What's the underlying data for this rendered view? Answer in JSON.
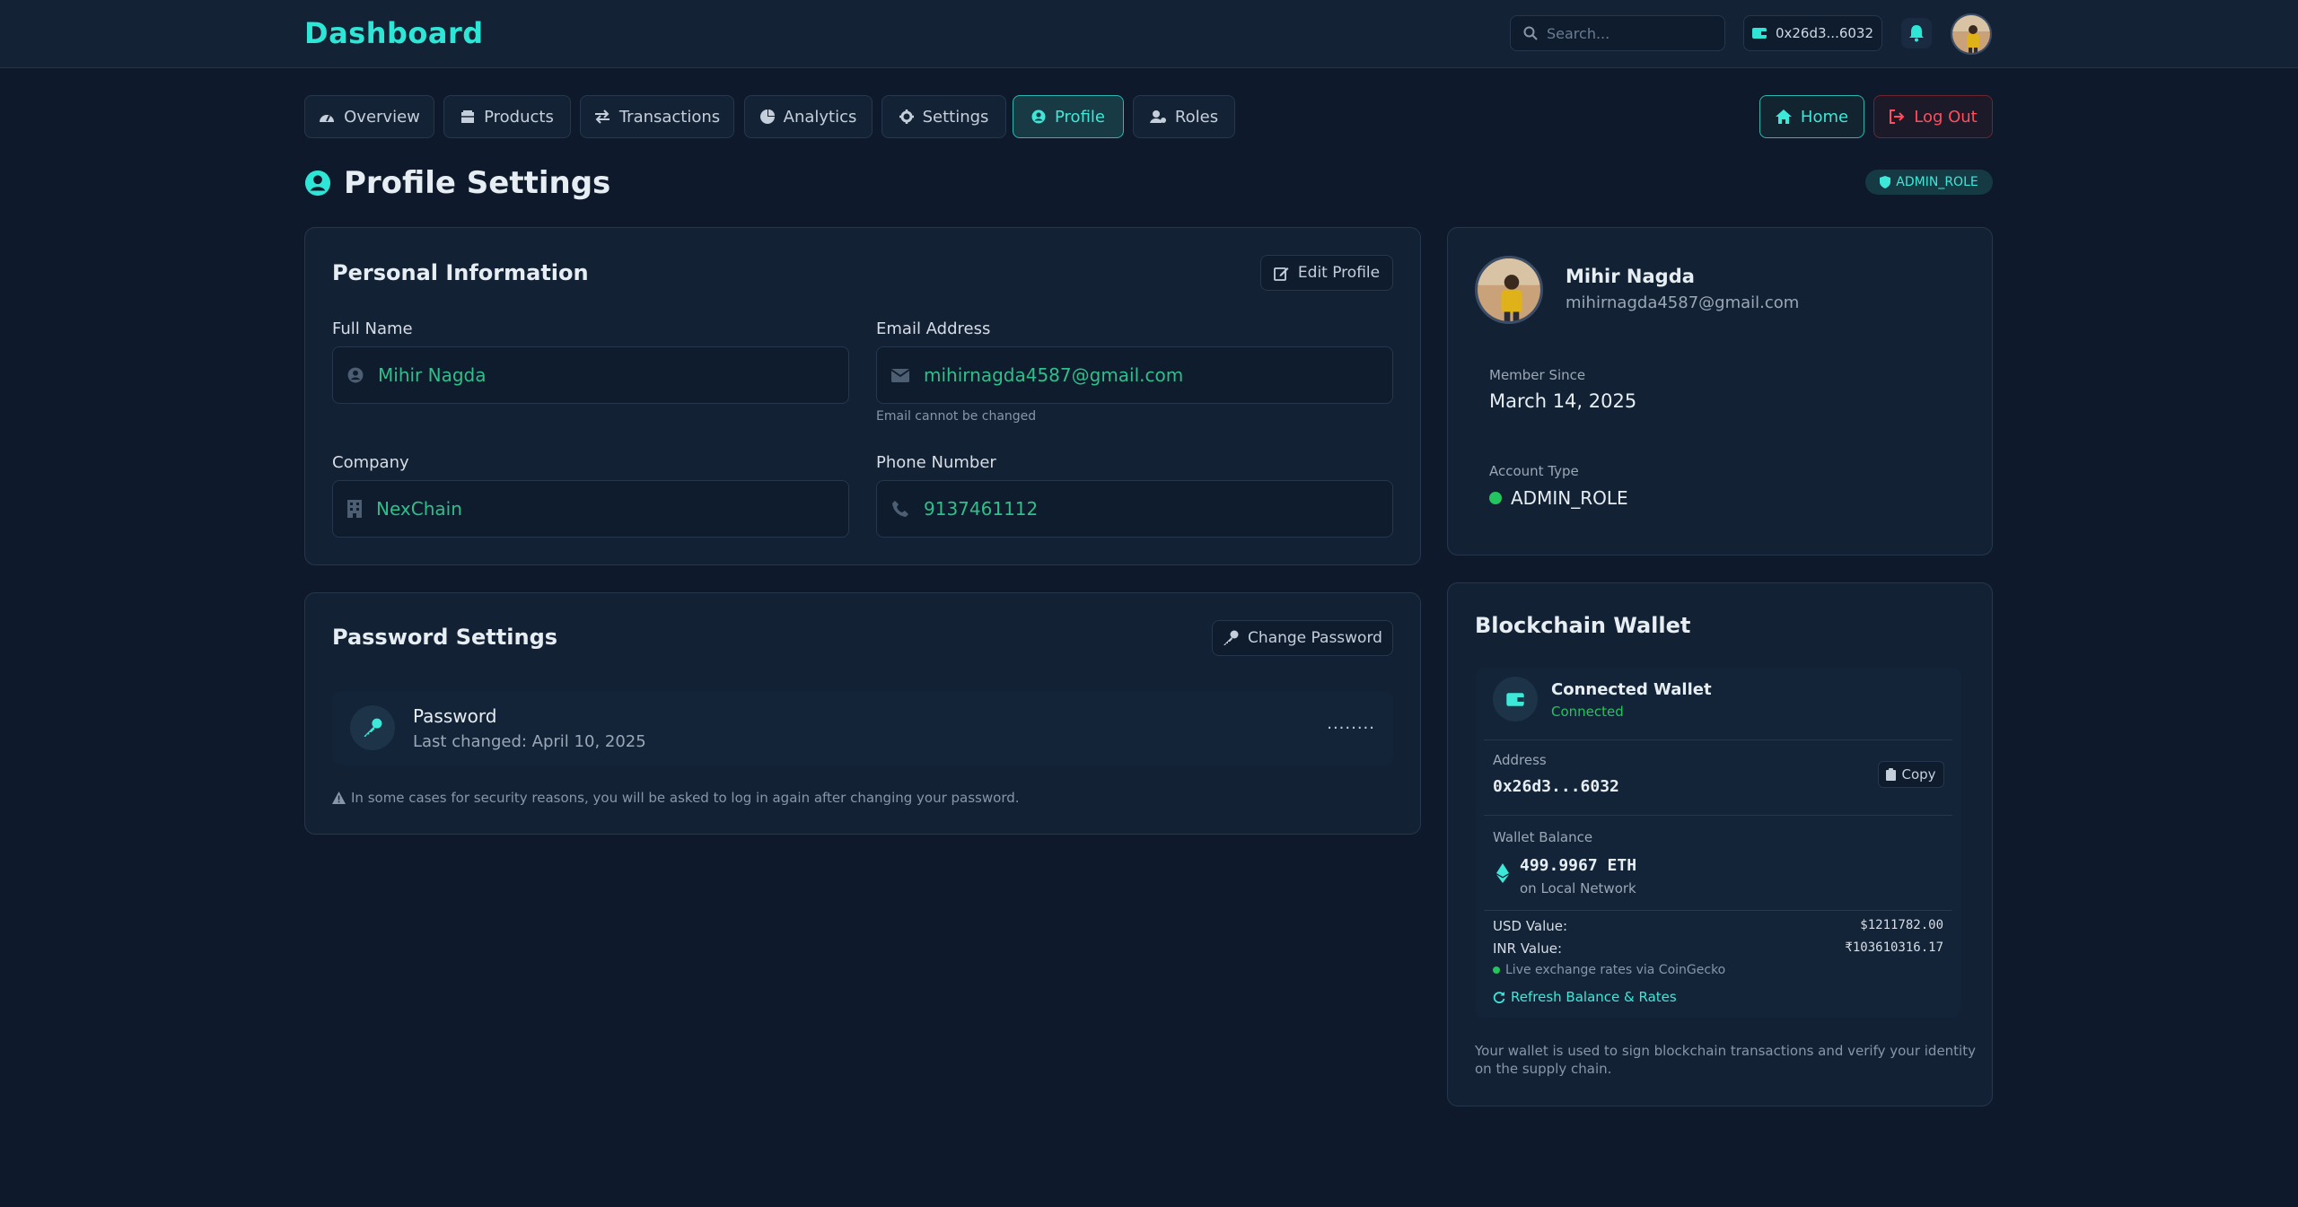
{
  "header": {
    "brand": "Dashboard",
    "search_placeholder": "Search...",
    "wallet_short": "0x26d3...6032"
  },
  "nav": {
    "tabs": [
      {
        "label": "Overview",
        "icon": "gauge-icon"
      },
      {
        "label": "Products",
        "icon": "box-icon"
      },
      {
        "label": "Transactions",
        "icon": "exchange-icon"
      },
      {
        "label": "Analytics",
        "icon": "pie-chart-icon"
      },
      {
        "label": "Settings",
        "icon": "gear-icon"
      },
      {
        "label": "Profile",
        "icon": "user-circle-icon",
        "active": true
      },
      {
        "label": "Roles",
        "icon": "user-tag-icon"
      }
    ],
    "home_label": "Home",
    "logout_label": "Log Out"
  },
  "page": {
    "title": "Profile Settings",
    "role_badge": "ADMIN_ROLE"
  },
  "personal": {
    "title": "Personal Information",
    "edit_label": "Edit Profile",
    "full_name_label": "Full Name",
    "full_name": "Mihir Nagda",
    "email_label": "Email Address",
    "email": "mihirnagda4587@gmail.com",
    "email_hint": "Email cannot be changed",
    "company_label": "Company",
    "company": "NexChain",
    "phone_label": "Phone Number",
    "phone": "9137461112"
  },
  "password": {
    "title": "Password Settings",
    "change_label": "Change Password",
    "row_title": "Password",
    "last_changed": "Last changed: April 10, 2025",
    "masked": "........",
    "note": "In some cases for security reasons, you will be asked to log in again after changing your password."
  },
  "profile_card": {
    "name": "Mihir Nagda",
    "email": "mihirnagda4587@gmail.com",
    "member_since_label": "Member Since",
    "member_since": "March 14, 2025",
    "account_type_label": "Account Type",
    "account_type": "ADMIN_ROLE"
  },
  "wallet": {
    "title": "Blockchain Wallet",
    "connected_title": "Connected Wallet",
    "connected_status": "Connected",
    "address_label": "Address",
    "address": "0x26d3...6032",
    "copy_label": "Copy",
    "balance_label": "Wallet Balance",
    "balance": "499.9967 ETH",
    "network": "on Local Network",
    "usd_label": "USD Value:",
    "usd_value": "$1211782.00",
    "inr_label": "INR Value:",
    "inr_value": "₹103610316.17",
    "rates_note": "Live exchange rates via CoinGecko",
    "refresh_label": "Refresh Balance & Rates",
    "footer_note": "Your wallet is used to sign blockchain transactions and verify your identity on the supply chain."
  },
  "colors": {
    "accent": "#2ee6d6",
    "field_text": "#2fbf8a",
    "danger": "#ff4d5e",
    "success": "#22c55e",
    "background": "#0e1a2b"
  }
}
